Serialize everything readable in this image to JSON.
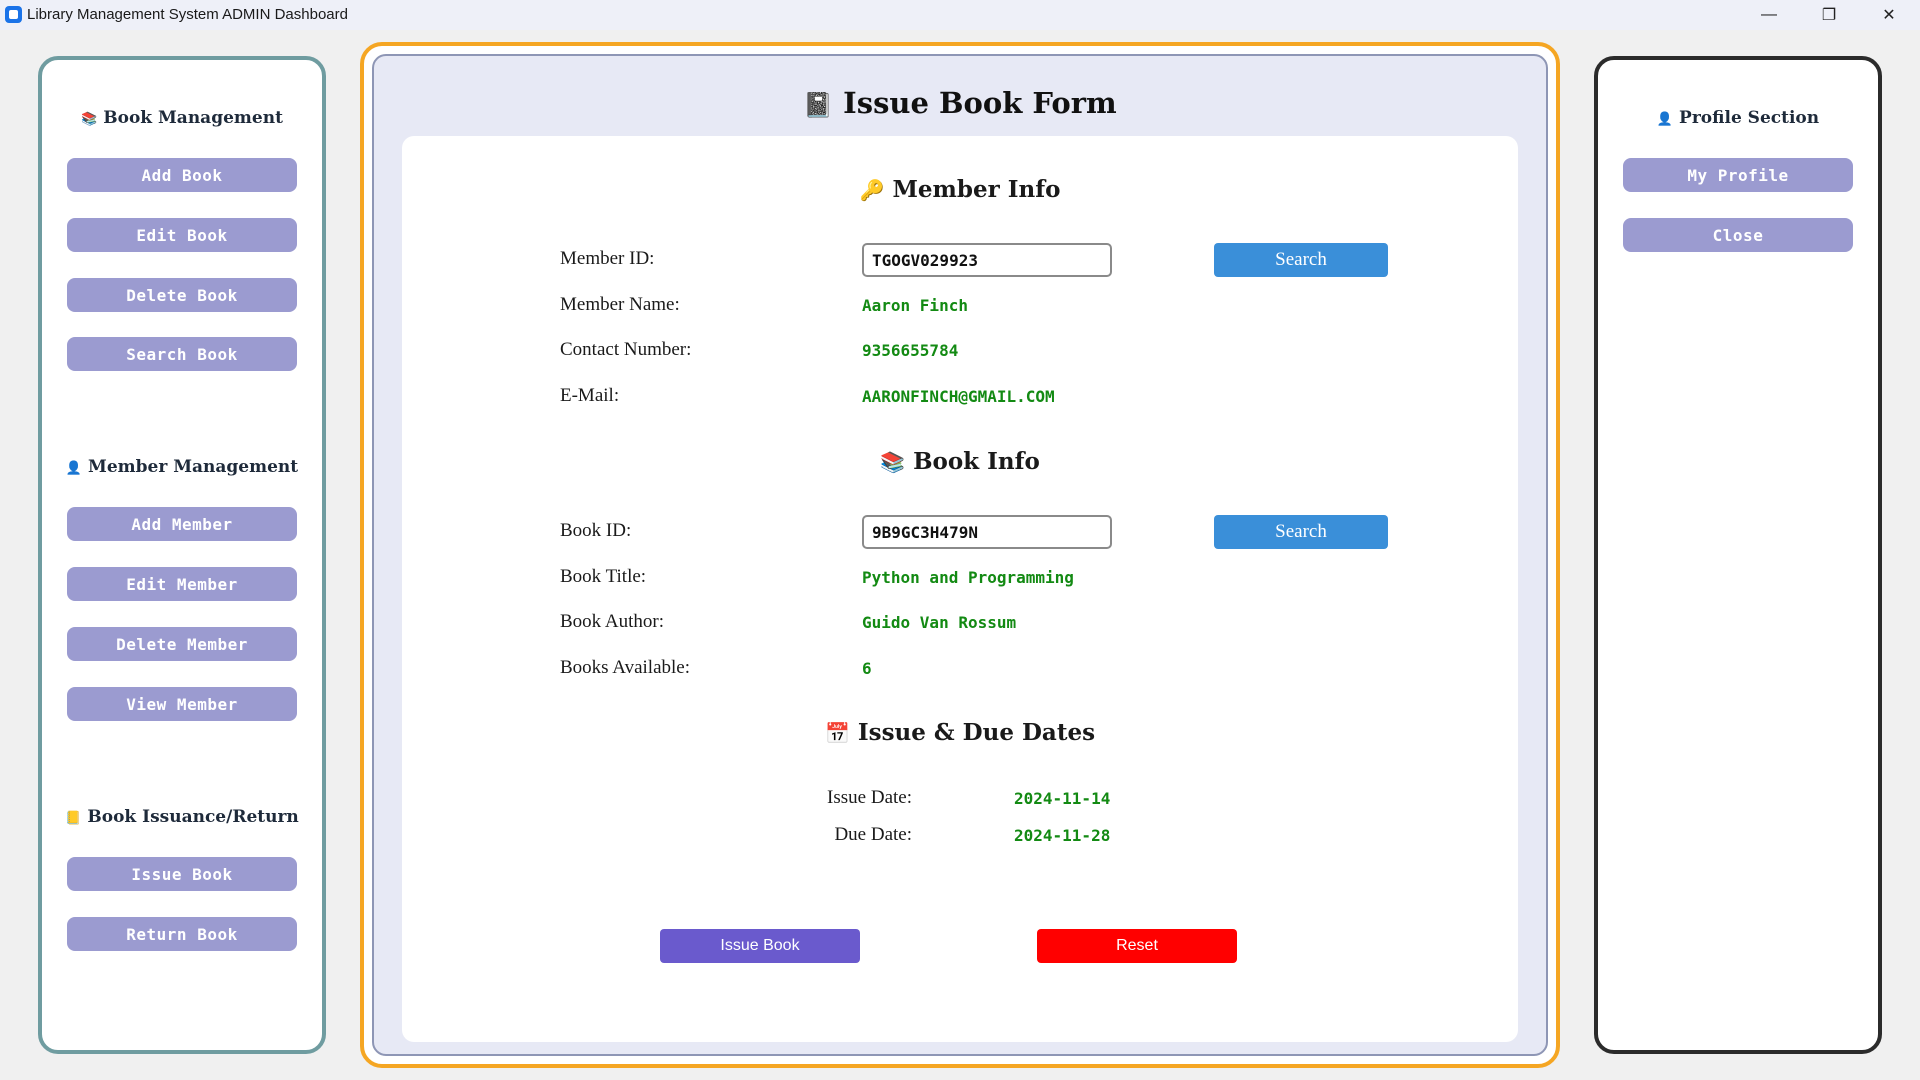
{
  "window": {
    "title": "Library Management System ADMIN Dashboard",
    "min_glyph": "—",
    "max_glyph": "❐",
    "close_glyph": "✕"
  },
  "sidebar": {
    "book_management": {
      "title": "Book Management",
      "icon": "books-icon",
      "icon_glyph": "📚",
      "buttons": [
        "Add Book",
        "Edit Book",
        "Delete Book",
        "Search Book"
      ]
    },
    "member_management": {
      "title": "Member Management",
      "icon": "person-icon",
      "icon_glyph": "👤",
      "buttons": [
        "Add Member",
        "Edit Member",
        "Delete Member",
        "View Member"
      ]
    },
    "issuance": {
      "title": "Book Issuance/Return",
      "icon": "ledger-icon",
      "icon_glyph": "📒",
      "buttons": [
        "Issue Book",
        "Return Book"
      ]
    }
  },
  "profile": {
    "title": "Profile Section",
    "icon": "person-icon",
    "icon_glyph": "👤",
    "buttons": [
      "My Profile",
      "Close"
    ]
  },
  "form": {
    "title": "Issue Book Form",
    "title_icon": "notebook-icon",
    "title_icon_glyph": "📓",
    "member_info": {
      "heading": "Member Info",
      "icon": "key-icon",
      "icon_glyph": "🔑",
      "member_id_label": "Member ID:",
      "member_id_value": "TGOGV029923",
      "search_label": "Search",
      "name_label": "Member Name:",
      "name_value": "Aaron Finch",
      "contact_label": "Contact Number:",
      "contact_value": "9356655784",
      "email_label": "E-Mail:",
      "email_value": "AARONFINCH@GMAIL.COM"
    },
    "book_info": {
      "heading": "Book Info",
      "icon": "books-icon",
      "icon_glyph": "📚",
      "book_id_label": "Book ID:",
      "book_id_value": "9B9GC3H479N",
      "search_label": "Search",
      "title_label": "Book Title:",
      "title_value": "Python and Programming",
      "author_label": "Book Author:",
      "author_value": "Guido Van Rossum",
      "available_label": "Books Available:",
      "available_value": "6"
    },
    "dates": {
      "heading": "Issue & Due Dates",
      "icon": "calendar-icon",
      "icon_glyph": "📅",
      "issue_label": "Issue Date:",
      "issue_value": "2024-11-14",
      "due_label": "Due Date:",
      "due_value": "2024-11-28"
    },
    "issue_button": "Issue Book",
    "reset_button": "Reset"
  },
  "colors": {
    "side_button": "#9b9bd0",
    "search_button": "#3a8fd9",
    "issue_button": "#6a5acd",
    "reset_button": "#ff0000",
    "value_text": "#138a13",
    "center_border": "#f5a623"
  }
}
